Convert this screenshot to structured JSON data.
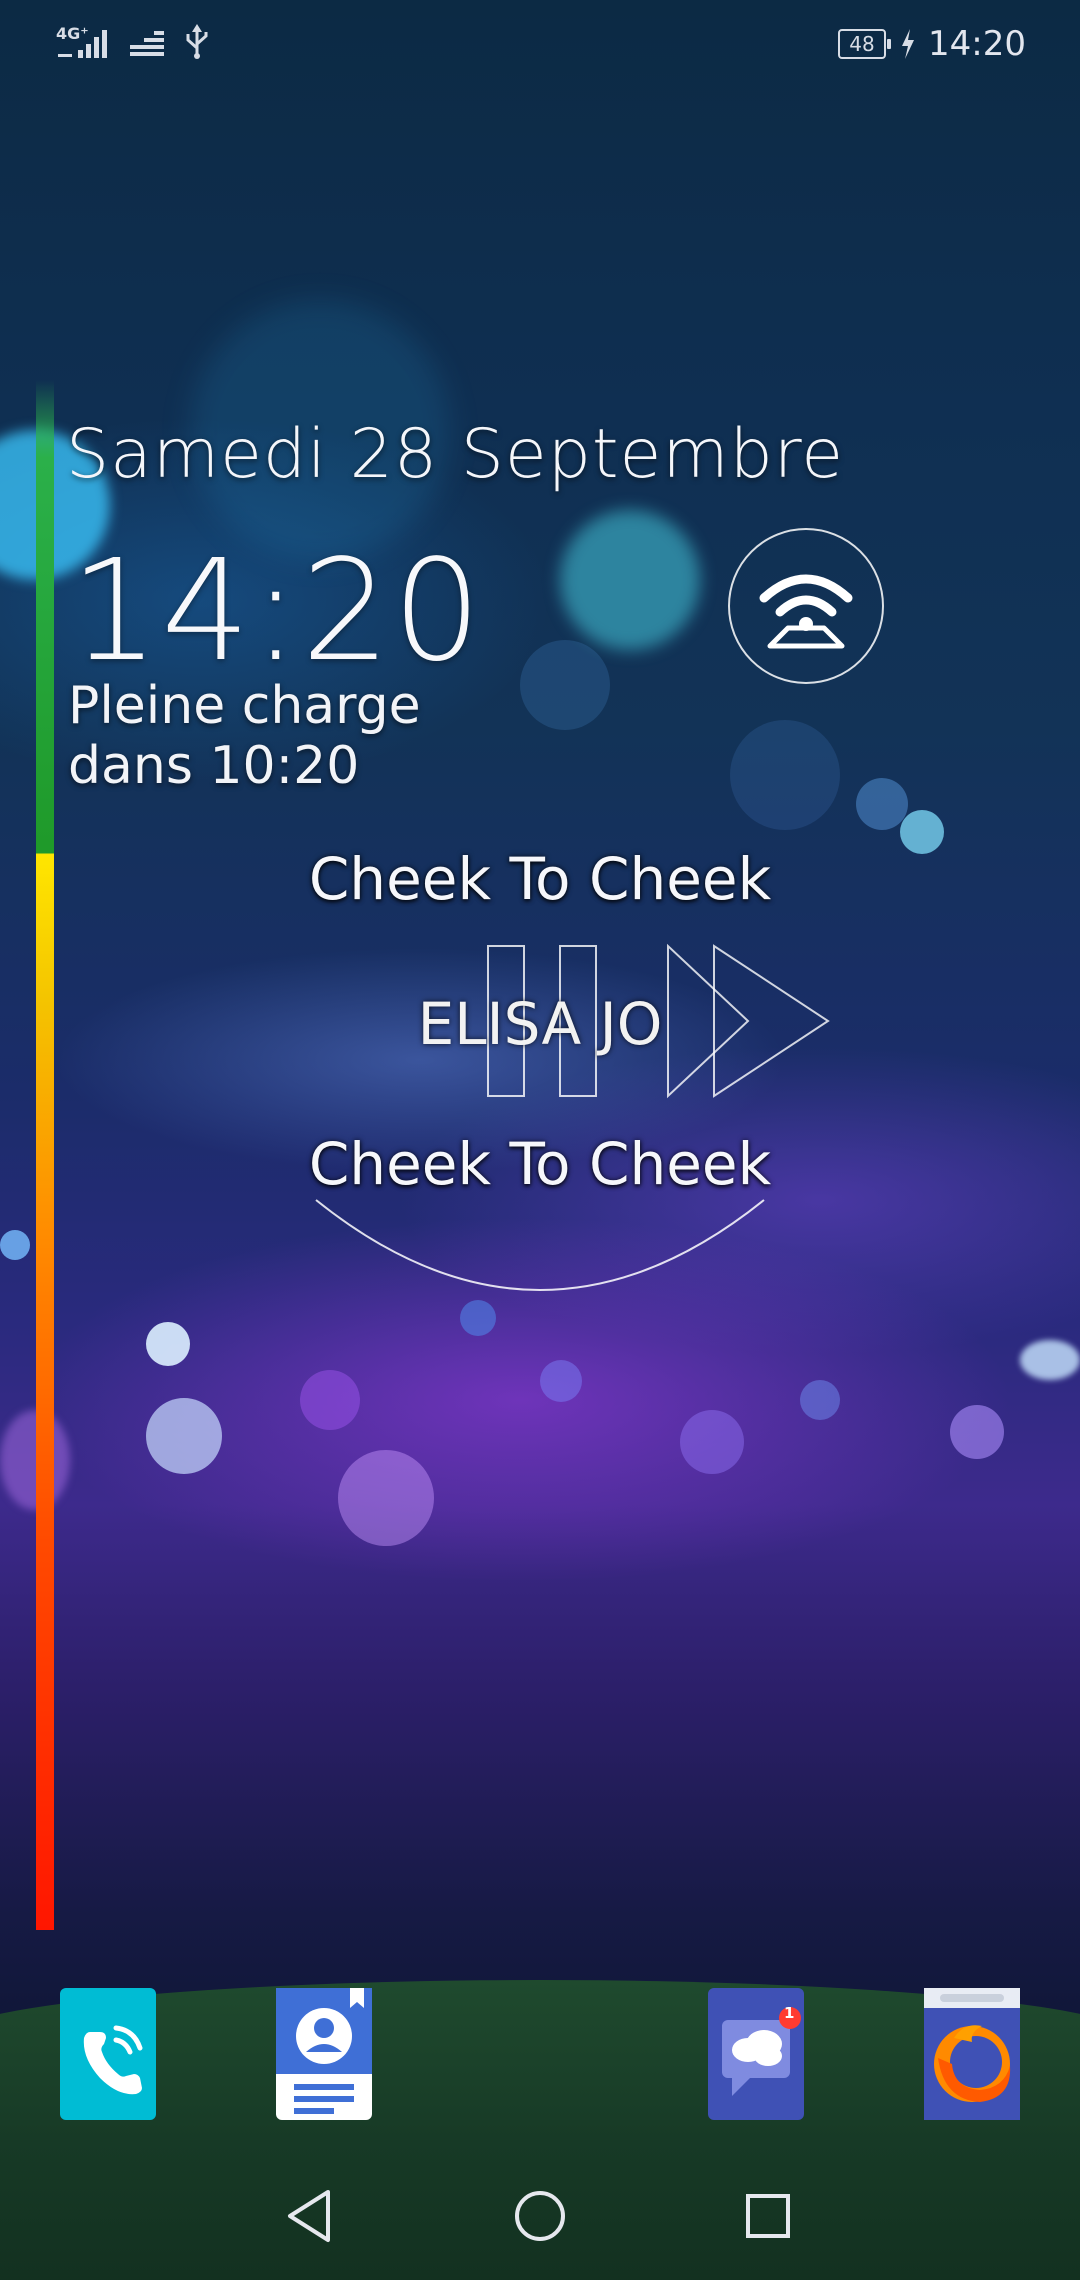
{
  "status_bar": {
    "network_label": "4G⁺",
    "battery_level": "48",
    "time": "14:20"
  },
  "lockscreen": {
    "date": "Samedi 28 Septembre",
    "time": "14:20",
    "charge_status": "Pleine charge dans 10:20",
    "charge_level_fraction": 0.48
  },
  "music": {
    "title": "Cheek To Cheek",
    "artist": "ELISA JO",
    "album": "Cheek To Cheek"
  },
  "dock": {
    "apps": [
      {
        "name": "Phone",
        "icon": "phone-icon"
      },
      {
        "name": "Contacts",
        "icon": "contacts-icon"
      },
      {
        "name": "Messages",
        "icon": "messages-icon",
        "badge": "1"
      },
      {
        "name": "Firefox",
        "icon": "firefox-icon"
      }
    ]
  },
  "navigation": {
    "buttons": [
      "back-icon",
      "home-icon",
      "recents-icon"
    ]
  },
  "colors": {
    "phone_app": "#00bcd4",
    "contacts_app": "#ffffff",
    "messages_app": "#3f51b5",
    "badge": "#ff3b30"
  }
}
